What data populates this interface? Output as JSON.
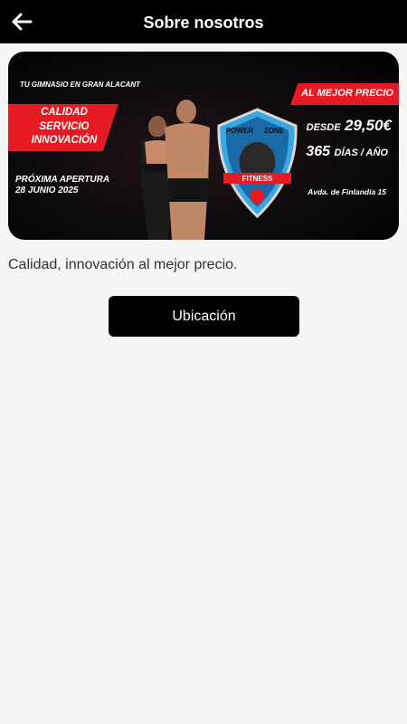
{
  "header": {
    "title": "Sobre nosotros",
    "back_icon": "arrow-left-icon"
  },
  "banner": {
    "tagline": "TU GIMNASIO EN GRAN ALACANT",
    "features": [
      "CALIDAD",
      "SERVICIO",
      "INNOVACIÓN"
    ],
    "opening_label": "PRÓXIMA APERTURA",
    "opening_date": "28 JUNIO 2025",
    "best_price": "AL MEJOR PRECIO",
    "price_prefix": "DESDE",
    "price_value": "29,50€",
    "days_value": "365",
    "days_suffix": "DÍAS / AÑO",
    "address": "Avda. de Finlandia 15",
    "logo_text_top_left": "POWER",
    "logo_text_top_right": "ZONE",
    "logo_text_bottom": "FITNESS",
    "colors": {
      "red": "#e51a22",
      "shield_blue": "#3aa8e0"
    }
  },
  "content": {
    "description": "Calidad, innovación al mejor precio.",
    "location_button": "Ubicación"
  }
}
